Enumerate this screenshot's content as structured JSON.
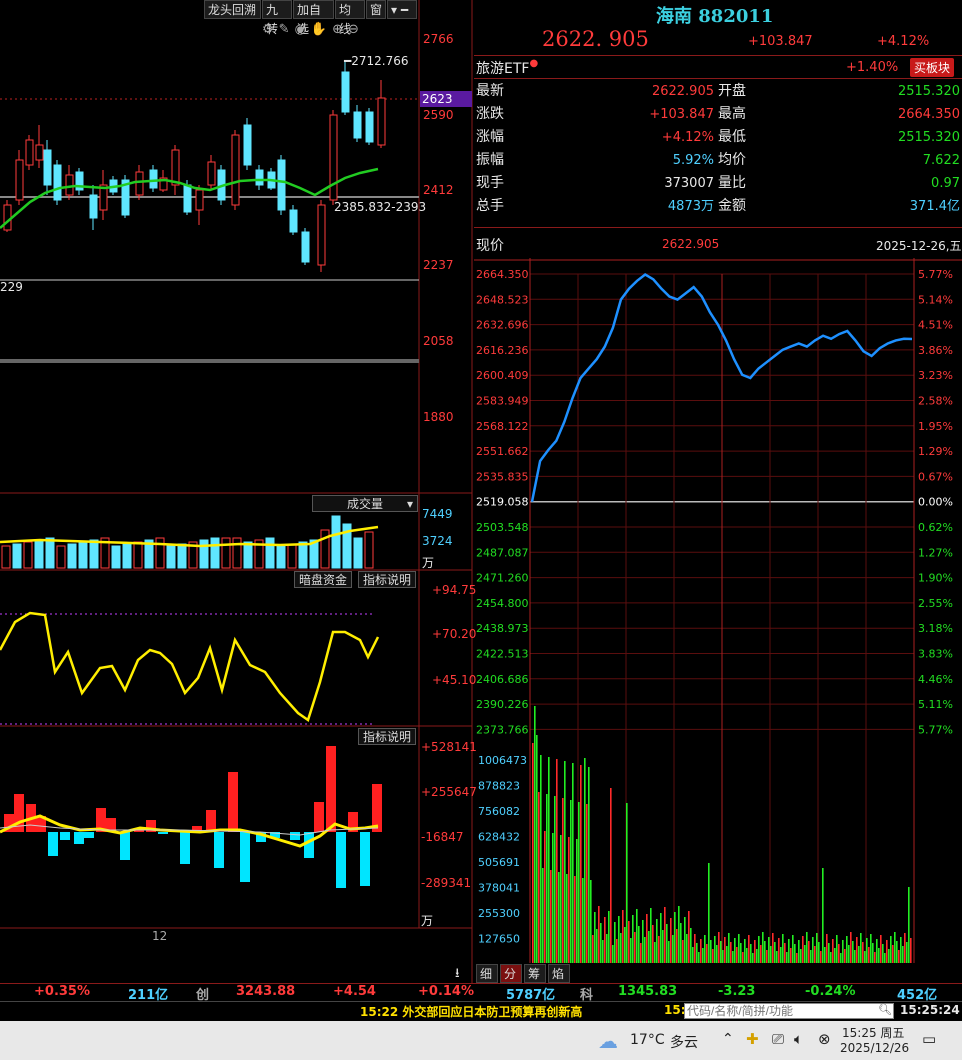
{
  "left_toolbar": {
    "tabs": [
      "龙头回溯",
      "九转",
      "加自选",
      "均线",
      "窗"
    ],
    "menu_icon": "menu-icon"
  },
  "kline": {
    "price_ticks": [
      "2766",
      "2590",
      "2412",
      "2237",
      "2058",
      "1880"
    ],
    "current_price_tag": "2623",
    "high_label": "2712.766",
    "low_label": "2385.832-2393",
    "lowest_label": "229",
    "x_label": "12"
  },
  "volume": {
    "dropdown_label": "成交量",
    "ticks": [
      "7449",
      "3724"
    ],
    "unit": "万"
  },
  "dark_pool": {
    "label": "暗盘资金",
    "explain": "指标说明",
    "ticks": [
      "+94.75",
      "+70.20",
      "+45.10"
    ]
  },
  "money_flow": {
    "explain": "指标说明",
    "ticks": [
      "+528141",
      "+255647",
      "-16847",
      "-289341"
    ],
    "unit": "万"
  },
  "quote": {
    "name": "海南 882011",
    "price": "2622. 905",
    "change": "+103.847",
    "change_pct": "+4.12%",
    "etf_label": "旅游ETF",
    "etf_pct": "+1.40%",
    "buy_board": "买板块",
    "rows": [
      {
        "l1": "最新",
        "v1": "2622.905",
        "l2": "开盘",
        "v2": "2515.320"
      },
      {
        "l1": "涨跌",
        "v1": "+103.847",
        "l2": "最高",
        "v2": "2664.350"
      },
      {
        "l1": "涨幅",
        "v1": "+4.12%",
        "l2": "最低",
        "v2": "2515.320"
      },
      {
        "l1": "振幅",
        "v1": "5.92%",
        "l2": "均价",
        "v2": "7.622"
      },
      {
        "l1": "现手",
        "v1": "373007",
        "l2": "量比",
        "v2": "0.97"
      },
      {
        "l1": "总手",
        "v1": "4873万",
        "l2": "金额",
        "v2": "371.4亿"
      }
    ]
  },
  "intraday": {
    "header_label": "现价",
    "header_price": "2622.905",
    "date": "2025-12-26,五",
    "price_levels": [
      "2664.350",
      "2648.523",
      "2632.696",
      "2616.236",
      "2600.409",
      "2583.949",
      "2568.122",
      "2551.662",
      "2535.835",
      "2519.058",
      "2503.548",
      "2487.087",
      "2471.260",
      "2454.800",
      "2438.973",
      "2422.513",
      "2406.686",
      "2390.226",
      "2373.766"
    ],
    "pct_levels": [
      "5.77%",
      "5.14%",
      "4.51%",
      "3.86%",
      "3.23%",
      "2.58%",
      "1.95%",
      "1.29%",
      "0.67%",
      "0.00%",
      "0.62%",
      "1.27%",
      "1.90%",
      "2.55%",
      "3.18%",
      "3.83%",
      "4.46%",
      "5.11%",
      "5.77%"
    ],
    "vol_levels": [
      "1006473",
      "878823",
      "756082",
      "628432",
      "505691",
      "378041",
      "255300",
      "127650"
    ],
    "bottom_tabs": [
      "细",
      "分",
      "筹",
      "焰"
    ],
    "series_color": "#1e90ff"
  },
  "status_bar": {
    "items": [
      "+0.35%",
      "211亿",
      "创",
      "3243.88",
      "+4.54",
      "+0.14%",
      "5787亿",
      "科",
      "1345.83",
      "-3.23",
      "-0.24%",
      "452亿"
    ],
    "news": "15:22 外交部回应日本防卫预算再创新高",
    "news_prefix": "15:",
    "search_placeholder": "代码/名称/简拼/功能",
    "clock": "15:25:24"
  },
  "taskbar": {
    "weather_temp": "17°C",
    "weather_text": "多云",
    "time": "15:25 周五",
    "date": "2025/12/26"
  },
  "chart_data": {
    "type": "line",
    "title": "",
    "ylim": [
      2373.766,
      2664.35
    ],
    "y_start": 2519.058,
    "y": [
      2519.058,
      2545,
      2552,
      2558,
      2570,
      2585,
      2598,
      2604,
      2610,
      2618,
      2630,
      2648,
      2655,
      2660,
      2664,
      2661,
      2655,
      2650,
      2648,
      2652,
      2656,
      2650,
      2640,
      2632,
      2622,
      2610,
      2600,
      2598,
      2604,
      2608,
      2612,
      2616,
      2618,
      2620,
      2618,
      2622,
      2625,
      2623,
      2626,
      2628,
      2622,
      2615,
      2612,
      2617,
      2620,
      2622,
      2623,
      2622.905
    ]
  }
}
